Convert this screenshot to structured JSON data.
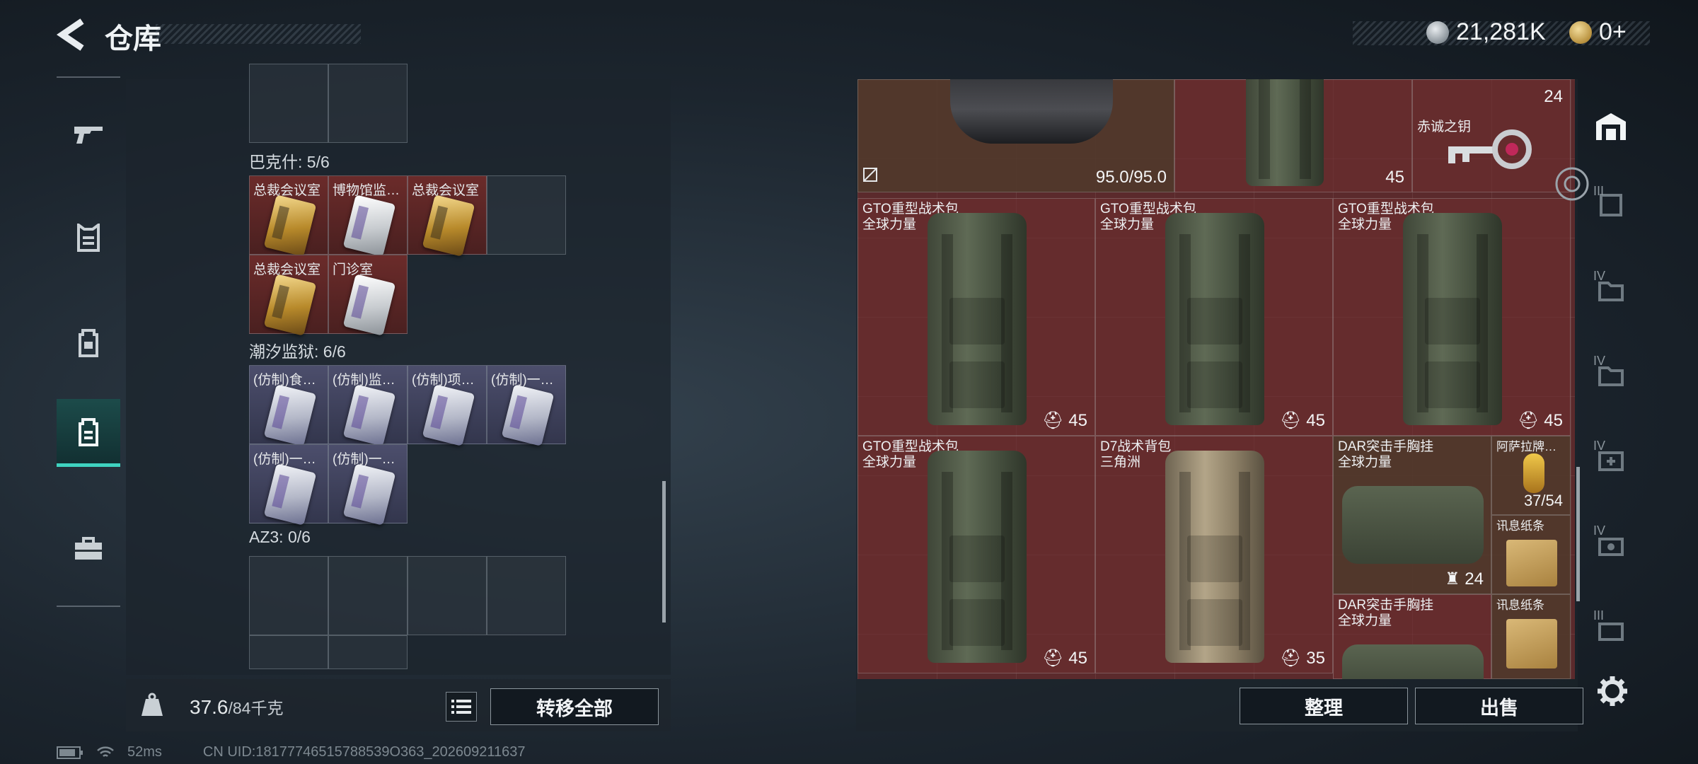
{
  "header": {
    "title": "仓库",
    "currency_1": "21,281K",
    "currency_2": "0+"
  },
  "left_panel": {
    "sections": [
      {
        "label": "巴克什: 5/6"
      },
      {
        "label": "潮汐监狱: 6/6"
      },
      {
        "label": "AZ3: 0/6"
      }
    ],
    "bakesh_slots": [
      "总裁会议室",
      "博物馆监…",
      "总裁会议室",
      "总裁会议室",
      "门诊室"
    ],
    "prison_slots": [
      "(仿制)食…",
      "(仿制)监…",
      "(仿制)项…",
      "(仿制)一…",
      "(仿制)一…",
      "(仿制)一…"
    ]
  },
  "bottom_left": {
    "weight_current": "37.6",
    "weight_max": "/84千克",
    "transfer_label": "转移全部"
  },
  "grid_items": [
    {
      "name": "",
      "stat": "95.0/95.0"
    },
    {
      "name": "",
      "stat": "45"
    },
    {
      "name": "赤诚之钥",
      "stat": "24"
    },
    {
      "name": "GTO重型战术包",
      "sub": "全球力量",
      "stat": "45"
    },
    {
      "name": "GTO重型战术包",
      "sub": "全球力量",
      "stat": "45"
    },
    {
      "name": "GTO重型战术包",
      "sub": "全球力量",
      "stat": "45"
    },
    {
      "name": "GTO重型战术包",
      "sub": "全球力量",
      "stat": "45"
    },
    {
      "name": "D7战术背包",
      "sub": "三角洲",
      "stat": "35"
    },
    {
      "name": "DAR突击手胸挂",
      "sub": "全球力量",
      "stat": "24"
    },
    {
      "name": "阿萨拉牌…",
      "stat": "37/54"
    },
    {
      "name": "讯息纸条"
    },
    {
      "name": "DAR突击手胸挂",
      "sub": "全球力量"
    },
    {
      "name": "讯息纸条"
    }
  ],
  "bottom_right": {
    "sort_label": "整理",
    "sell_label": "出售"
  },
  "right_nav": {
    "levels": [
      "III",
      "IV",
      "IV",
      "IV",
      "IV",
      "III"
    ]
  },
  "status": {
    "ping": "52ms",
    "uid": "CN UID:18177746515788539O363_202609211637"
  }
}
